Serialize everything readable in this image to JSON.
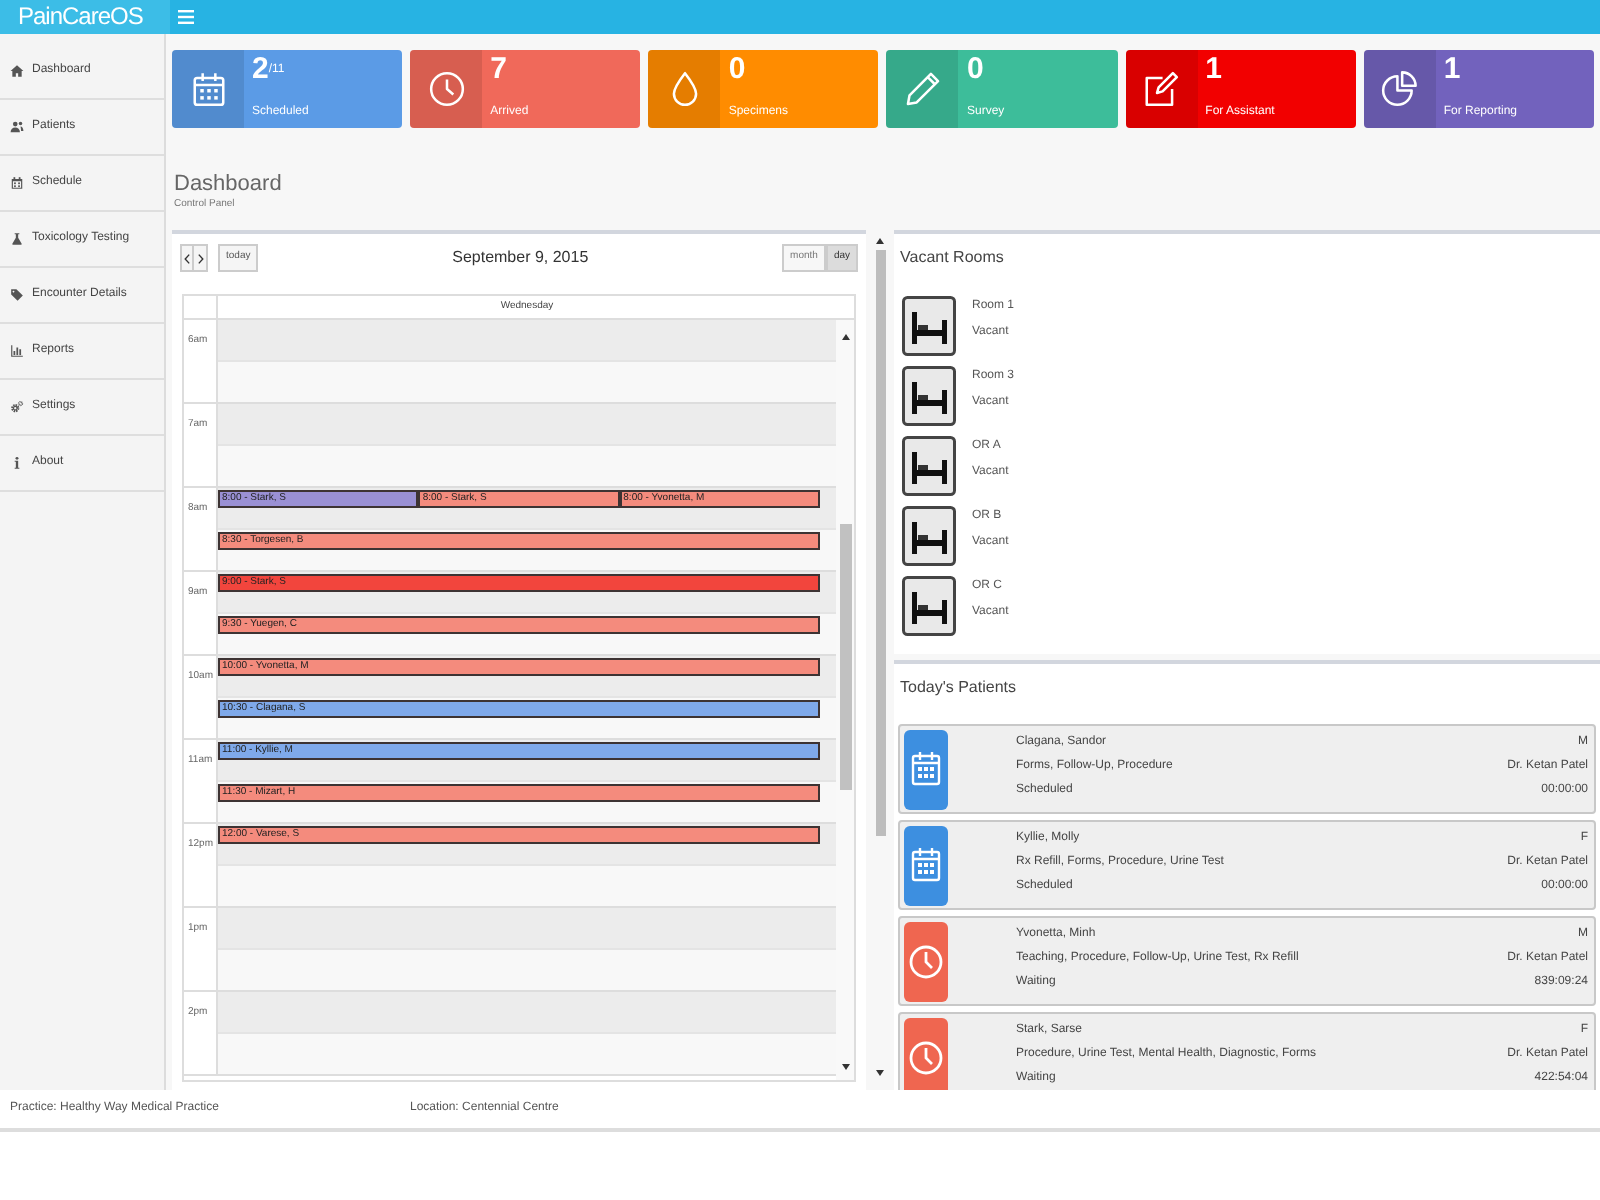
{
  "top_bar": {
    "logo": "PainCareOS"
  },
  "sidebar": {
    "items": [
      {
        "label": "Dashboard"
      },
      {
        "label": "Patients"
      },
      {
        "label": "Schedule"
      },
      {
        "label": "Toxicology Testing"
      },
      {
        "label": "Encounter Details"
      },
      {
        "label": "Reports"
      },
      {
        "label": "Settings"
      },
      {
        "label": "About"
      }
    ]
  },
  "stat_cards": [
    {
      "value": "2$^{/11}$",
      "label": "Scheduled",
      "color": "#5b9be6"
    },
    {
      "value": "7",
      "label": "Arrived",
      "color": "#f0695a"
    },
    {
      "value": "0",
      "label": "Specimens",
      "color": "#ff8c00"
    },
    {
      "value": "0",
      "label": "Survey",
      "color": "#3dbd9a"
    },
    {
      "value": "1",
      "label": "For Assistant",
      "color": "#f20000"
    },
    {
      "value": "1",
      "label": "For Reporting",
      "color": "#7262bd"
    }
  ],
  "page_header": {
    "title": "Dashboard",
    "subtitle": "Control Panel"
  },
  "calendar": {
    "today_button": "today",
    "title": "September 9, 2015",
    "views": [
      {
        "label": "month",
        "selected": false
      },
      {
        "label": "day",
        "selected": true
      }
    ],
    "day_header": "Wednesday",
    "hours": [
      {
        "label": "6am"
      },
      {
        "label": "7am"
      },
      {
        "label": "8am",
        "on_the_hour": [
          {
            "label": "8:00 - Stark, S",
            "color": "#9a90d4"
          },
          {
            "label": "8:00 - Stark, S",
            "color": "#f48b7d"
          },
          {
            "label": "8:00 - Yvonetta, M",
            "color": "#f48b7d"
          }
        ],
        "half_past": [
          {
            "label": "8:30 - Torgesen, B",
            "color": "#f48b7d"
          }
        ]
      },
      {
        "label": "9am",
        "on_the_hour": [
          {
            "label": "9:00 - Stark, S",
            "color": "#f2453d"
          }
        ],
        "half_past": [
          {
            "label": "9:30 - Yuegen, C",
            "color": "#f48b7d"
          }
        ]
      },
      {
        "label": "10am",
        "on_the_hour": [
          {
            "label": "10:00 - Yvonetta, M",
            "color": "#f48b7d"
          }
        ],
        "half_past": [
          {
            "label": "10:30 - Clagana, S",
            "color": "#7fa9ea"
          }
        ]
      },
      {
        "label": "11am",
        "on_the_hour": [
          {
            "label": "11:00 - Kyllie, M",
            "color": "#7fa9ea"
          }
        ],
        "half_past": [
          {
            "label": "11:30 - Mizart, H",
            "color": "#f48b7d"
          }
        ]
      },
      {
        "label": "12pm",
        "on_the_hour": [
          {
            "label": "12:00 - Varese, S",
            "color": "#f48b7d"
          }
        ]
      },
      {
        "label": "1pm"
      },
      {
        "label": "2pm"
      }
    ]
  },
  "vacant_rooms": {
    "title": "Vacant Rooms",
    "rooms": [
      {
        "name": "Room 1",
        "status": "Vacant"
      },
      {
        "name": "Room 3",
        "status": "Vacant"
      },
      {
        "name": "OR A",
        "status": "Vacant"
      },
      {
        "name": "OR B",
        "status": "Vacant"
      },
      {
        "name": "OR C",
        "status": "Vacant"
      }
    ]
  },
  "todays_patients": {
    "title": "Today's Patients",
    "patients": [
      {
        "kind": "scheduled",
        "name": "Clagana, Sandor",
        "reasons": "Forms, Follow-Up, Procedure",
        "status": "Scheduled",
        "sex": "M",
        "doctor": "Dr. Ketan Patel",
        "timer": "00:00:00"
      },
      {
        "kind": "scheduled",
        "name": "Kyllie, Molly",
        "reasons": "Rx Refill, Forms, Procedure, Urine Test",
        "status": "Scheduled",
        "sex": "F",
        "doctor": "Dr. Ketan Patel",
        "timer": "00:00:00"
      },
      {
        "kind": "waiting",
        "name": "Yvonetta, Minh",
        "reasons": "Teaching, Procedure, Follow-Up, Urine Test, Rx Refill",
        "status": "Waiting",
        "sex": "M",
        "doctor": "Dr. Ketan Patel",
        "timer": "839:09:24"
      },
      {
        "kind": "waiting",
        "name": "Stark, Sarse",
        "reasons": "Procedure, Urine Test, Mental Health, Diagnostic, Forms",
        "status": "Waiting",
        "sex": "F",
        "doctor": "Dr. Ketan Patel",
        "timer": "422:54:04"
      }
    ]
  },
  "footer": {
    "practice": "Practice: Healthy Way Medical Practice",
    "location": "Location: Centennial Centre"
  }
}
